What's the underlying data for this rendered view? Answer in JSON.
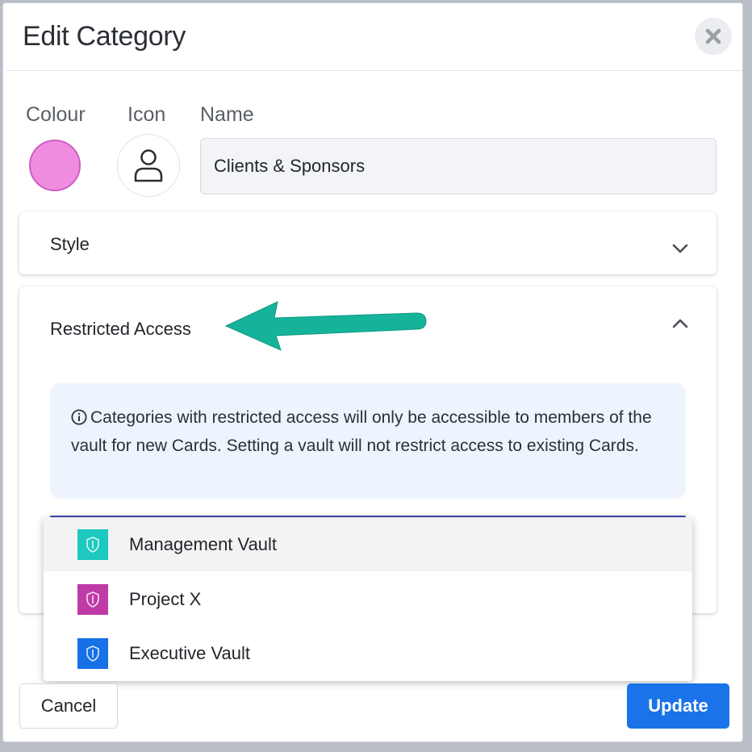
{
  "dialog": {
    "title": "Edit Category"
  },
  "fields": {
    "colour_label": "Colour",
    "icon_label": "Icon",
    "name_label": "Name",
    "colour_value": "#f08ce0",
    "icon": "user-icon",
    "name_value": "Clients & Sponsors"
  },
  "panels": {
    "style": {
      "title": "Style",
      "state": "collapsed"
    },
    "restricted": {
      "title": "Restricted Access",
      "state": "expanded",
      "info": "Categories with restricted access will only be accessible to members of the vault for new Cards. Setting a vault will not restrict access to existing Cards."
    }
  },
  "dropdown": {
    "options": [
      {
        "label": "Management Vault",
        "color": "#1cc8c0",
        "icon": "shield-icon",
        "highlighted": true
      },
      {
        "label": "Project X",
        "color": "#c03aa6",
        "icon": "shield-icon",
        "highlighted": false
      },
      {
        "label": "Executive Vault",
        "color": "#1670e6",
        "icon": "shield-icon",
        "highlighted": false
      }
    ]
  },
  "buttons": {
    "cancel": "Cancel",
    "update": "Update"
  },
  "colors": {
    "accent": "#1a73e8",
    "annotation_arrow": "#15b39a"
  }
}
